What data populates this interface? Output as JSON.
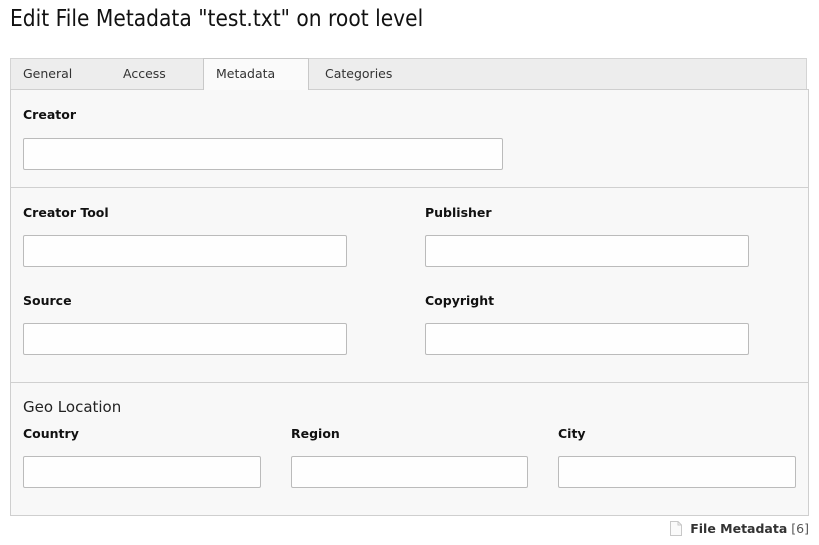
{
  "page": {
    "title": "Edit File Metadata \"test.txt\" on root level"
  },
  "tabs": [
    {
      "label": "General",
      "active": false
    },
    {
      "label": "Access",
      "active": false
    },
    {
      "label": "Metadata",
      "active": true
    },
    {
      "label": "Categories",
      "active": false
    }
  ],
  "fields": {
    "creator": {
      "label": "Creator",
      "value": ""
    },
    "creator_tool": {
      "label": "Creator Tool",
      "value": ""
    },
    "publisher": {
      "label": "Publisher",
      "value": ""
    },
    "source": {
      "label": "Source",
      "value": ""
    },
    "copyright": {
      "label": "Copyright",
      "value": ""
    },
    "country": {
      "label": "Country",
      "value": ""
    },
    "region": {
      "label": "Region",
      "value": ""
    },
    "city": {
      "label": "City",
      "value": ""
    }
  },
  "sections": {
    "geo_location": "Geo Location"
  },
  "footer": {
    "icon": "document-icon",
    "record_type": "File Metadata",
    "record_id": "[6]"
  }
}
